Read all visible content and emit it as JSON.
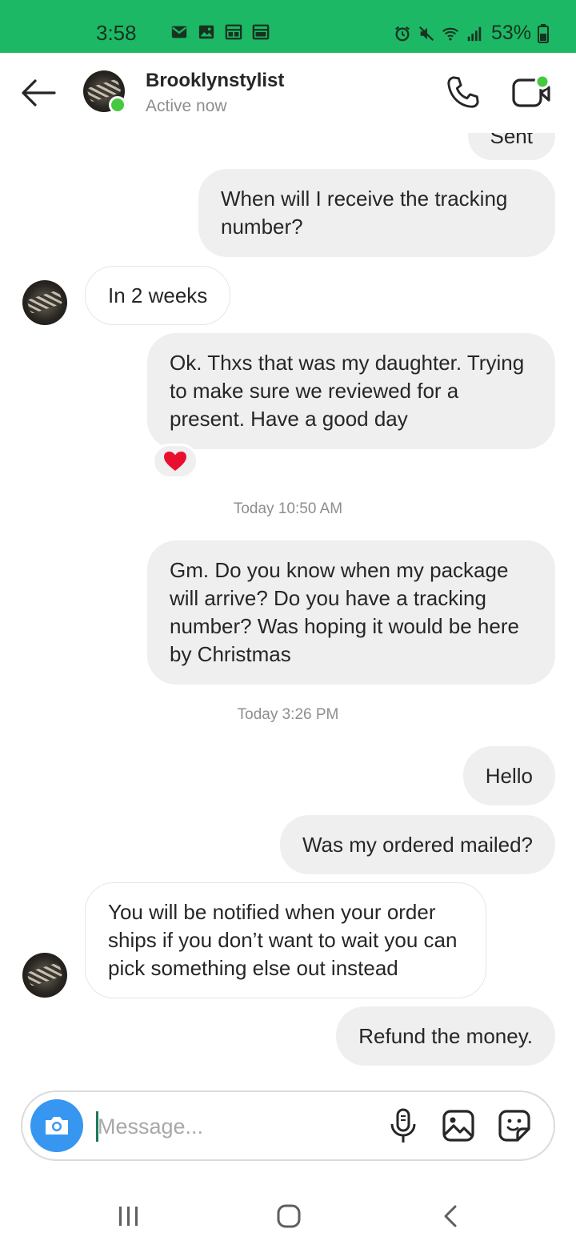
{
  "status_bar": {
    "time": "3:58",
    "battery": "53%",
    "left_icons": [
      "mail-icon",
      "image-icon",
      "calendar-icon",
      "calendar-icon"
    ],
    "right_icons": [
      "alarm-icon",
      "mute-icon",
      "wifi-icon",
      "signal-icon",
      "battery-icon"
    ],
    "background": "#1db866"
  },
  "header": {
    "contact_name": "Brooklynstylist",
    "contact_status": "Active now",
    "online_color": "#44c940"
  },
  "messages": [
    {
      "type": "out",
      "text": "Sent"
    },
    {
      "type": "out",
      "text": "When will I receive the tracking number?"
    },
    {
      "type": "in",
      "text": "In 2 weeks"
    },
    {
      "type": "out",
      "text": "Ok. Thxs that was my daughter. Trying to make sure we reviewed for a present. Have a good day",
      "reaction": "❤️"
    },
    {
      "type": "timestamp",
      "text": "Today 10:50 AM"
    },
    {
      "type": "out",
      "text": "Gm. Do you know when my package will arrive? Do you have a tracking number? Was hoping it would be here by Christmas"
    },
    {
      "type": "timestamp",
      "text": "Today 3:26 PM"
    },
    {
      "type": "out",
      "text": "Hello"
    },
    {
      "type": "out",
      "text": "Was my ordered mailed?"
    },
    {
      "type": "in",
      "text": "You will be notified when your order ships if you don’t want to wait you can pick something else out instead"
    },
    {
      "type": "out",
      "text": "Refund the money."
    }
  ],
  "composer": {
    "placeholder": "Message...",
    "value": "",
    "camera_color": "#3797f0"
  },
  "nav": {
    "buttons": [
      "recent-apps",
      "home",
      "back"
    ]
  }
}
